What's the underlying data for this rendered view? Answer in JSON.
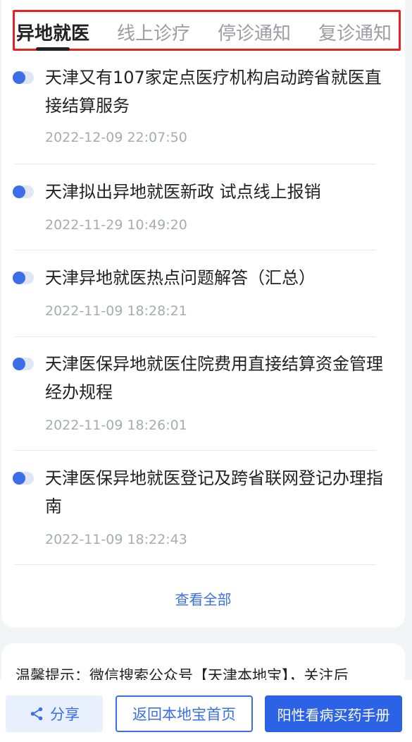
{
  "tabs": [
    {
      "label": "异地就医",
      "active": true
    },
    {
      "label": "线上诊疗",
      "active": false
    },
    {
      "label": "停诊通知",
      "active": false
    },
    {
      "label": "复诊通知",
      "active": false
    }
  ],
  "news": [
    {
      "title": "天津又有107家定点医疗机构启动跨省就医直接结算服务",
      "date": "2022-12-09 22:07:50"
    },
    {
      "title": "天津拟出异地就医新政 试点线上报销",
      "date": "2022-11-29 10:49:20"
    },
    {
      "title": "天津异地就医热点问题解答（汇总）",
      "date": "2022-11-09 18:28:21"
    },
    {
      "title": "天津医保异地就医住院费用直接结算资金管理经办规程",
      "date": "2022-11-09 18:26:01"
    },
    {
      "title": "天津医保异地就医登记及跨省联网登记办理指南",
      "date": "2022-11-09 18:22:43"
    }
  ],
  "view_all_label": "查看全部",
  "tip_text": "温馨提示：微信搜索公众号【天津本地宝】，关注后",
  "bottom": {
    "share_label": "分享",
    "home_label": "返回本地宝首页",
    "manual_label": "阳性看病买药手册"
  },
  "colors": {
    "accent": "#3b6ee8",
    "highlight_border": "#e32222"
  }
}
